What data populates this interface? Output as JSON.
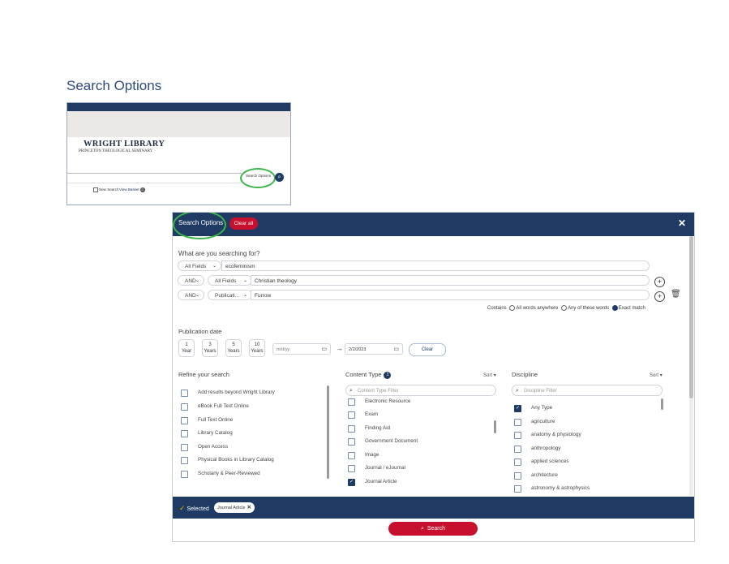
{
  "doc_title": "Search Options",
  "thumbnail": {
    "library_name": "WRIGHT LIBRARY",
    "library_subtitle": "PRINCETON THEOLOGICAL SEMINARY",
    "search_options_label": "Search Options",
    "new_search_label": "New Search",
    "view_basket_label": "View Basket",
    "basket_count": "0"
  },
  "modal": {
    "title": "Search Options",
    "clear_all": "Clear all",
    "close": "✕",
    "question": "What are you searching for?",
    "rows": [
      {
        "operator": "",
        "field": "All Fields",
        "value": "ecofeminism"
      },
      {
        "operator": "AND",
        "field": "All Fields",
        "value": "Christian theology"
      },
      {
        "operator": "AND",
        "field": "Publicati...",
        "value": "Furrow"
      }
    ],
    "contains_label": "Contains",
    "match_options": [
      "All words anywhere",
      "Any of these words",
      "Exact match"
    ],
    "match_selected": "Exact match",
    "pubdate_label": "Publication date",
    "year_buttons": [
      {
        "num": "1",
        "unit": "Year"
      },
      {
        "num": "3",
        "unit": "Years"
      },
      {
        "num": "5",
        "unit": "Years"
      },
      {
        "num": "10",
        "unit": "Years"
      }
    ],
    "date_from_placeholder": "m/d/yy",
    "date_to": "2/2/2023",
    "date_clear": "Clear",
    "refine": {
      "heading": "Refine your search",
      "items": [
        "Add results beyond Wright Library",
        "eBook Full Text Online",
        "Full Text Online",
        "Library Catalog",
        "Open Access",
        "Physical Books in Library Catalog",
        "Scholarly & Peer-Reviewed"
      ]
    },
    "content_type": {
      "heading": "Content Type",
      "count": "1",
      "sort": "Sort",
      "filter_placeholder": "Content Type Filter",
      "items": [
        {
          "label": "Electronic Resource",
          "checked": false
        },
        {
          "label": "Exam",
          "checked": false
        },
        {
          "label": "Finding Aid",
          "checked": false
        },
        {
          "label": "Government Document",
          "checked": false
        },
        {
          "label": "Image",
          "checked": false
        },
        {
          "label": "Journal / eJournal",
          "checked": false
        },
        {
          "label": "Journal Article",
          "checked": true
        }
      ]
    },
    "discipline": {
      "heading": "Discipline",
      "sort": "Sort",
      "filter_placeholder": "Discipline Filter",
      "items": [
        {
          "label": "Any Type",
          "checked": true
        },
        {
          "label": "agriculture",
          "checked": false
        },
        {
          "label": "anatomy & physiology",
          "checked": false
        },
        {
          "label": "anthropology",
          "checked": false
        },
        {
          "label": "applied sciences",
          "checked": false
        },
        {
          "label": "architecture",
          "checked": false
        },
        {
          "label": "astronomy & astrophysics",
          "checked": false
        }
      ]
    },
    "selected_label": "Selected",
    "selected_chip": "Journal Article",
    "search_button": "Search"
  },
  "colors": {
    "navy": "#1f3a63",
    "red": "#c8102e",
    "highlight_green": "#3cb54a"
  }
}
